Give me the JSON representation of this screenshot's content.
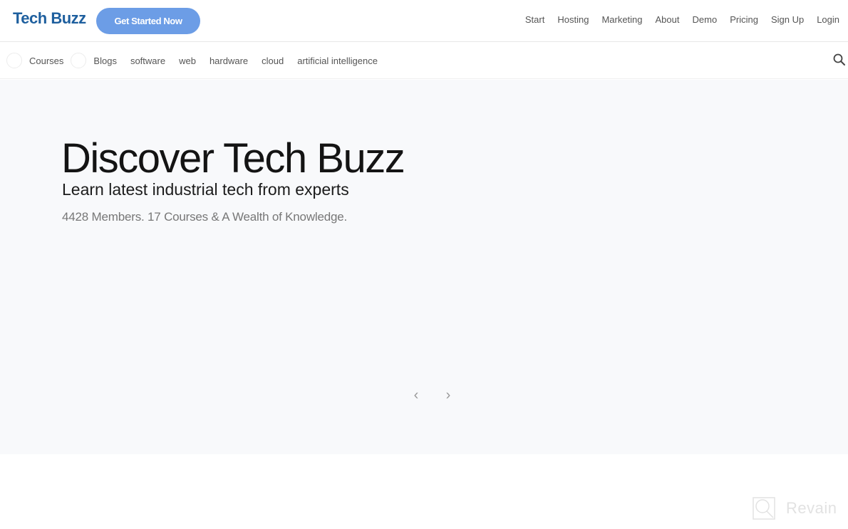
{
  "header": {
    "logo": "Tech Buzz",
    "cta_label": "Get Started Now",
    "nav": [
      "Start",
      "Hosting",
      "Marketing",
      "About",
      "Demo",
      "Pricing",
      "Sign Up",
      "Login"
    ]
  },
  "categories": {
    "items": [
      "Courses",
      "Blogs",
      "software",
      "web",
      "hardware",
      "cloud",
      "artificial intelligence"
    ],
    "search_icon": "search-icon"
  },
  "hero": {
    "title": "Discover Tech Buzz",
    "subtitle": "Learn latest industrial tech from experts",
    "stats": "4428 Members. 17 Courses & A Wealth of Knowledge.",
    "prev_icon": "‹",
    "next_icon": "›"
  },
  "watermark": {
    "text": "Revain"
  },
  "colors": {
    "brand": "#1e5f9e",
    "cta": "#6c9de6",
    "hero_bg": "#f8f9fb"
  }
}
